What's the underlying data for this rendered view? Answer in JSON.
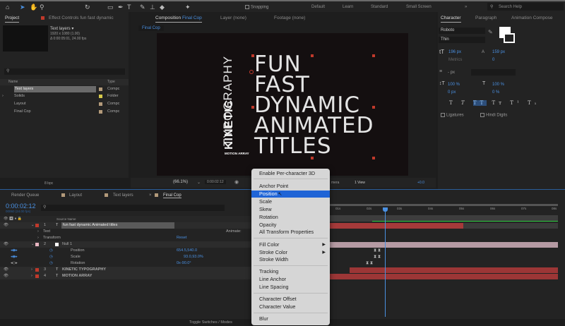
{
  "toolbar": {
    "snapping_label": "Snapping",
    "workspaces": [
      "Default",
      "Learn",
      "Standard",
      "Small Screen"
    ],
    "search_placeholder": "Search Help"
  },
  "project": {
    "tab_label": "Project",
    "effect_controls_label": "Effect Controls fun fast dynamic",
    "selected_name": "Text layers ▾",
    "selected_res": "1920 x 1080 (1.00)",
    "selected_dur": "Δ 0:00:05:01, 24.00 fps",
    "col_name": "Name",
    "col_type": "Type",
    "items": [
      {
        "name": "Text layers",
        "type": "Compc",
        "color": "#b39a7a"
      },
      {
        "name": "Solids",
        "type": "Folder",
        "color": "#d6c94a"
      },
      {
        "name": "Layout",
        "type": "Compc",
        "color": "#b39a7a"
      },
      {
        "name": "Final Cop",
        "type": "Compc",
        "color": "#b39a7a"
      }
    ],
    "bpc": "8 bpc"
  },
  "composition": {
    "tab_prefix": "Composition",
    "tab_name": "Final Cop",
    "layer_tab": "Layer (none)",
    "footage_tab": "Footage (none)",
    "breadcrumb": "Final Cop",
    "vertical_line1": "TYPOGRAPHY",
    "vertical_line2": "KINETIC",
    "vertical_line3": "MOTION ARRAY",
    "lines": [
      "FUN",
      "FAST",
      "DYNAMIC",
      "ANIMATED",
      "TITLES"
    ],
    "zoom": "(66.1%)",
    "timecode": "0:00:02:12",
    "camera": "mera",
    "view": "1 View",
    "exposure": "+0.0"
  },
  "character": {
    "tab_label": "Character",
    "paragraph_tab": "Paragraph",
    "animation_tab": "Animation Compose",
    "font": "Roboto",
    "style": "Thin",
    "font_size": "196 px",
    "leading": "159 px",
    "kerning": "Metrics",
    "tracking": "0",
    "stroke": "- px",
    "vscale": "100 %",
    "hscale": "100 %",
    "baseline": "0 px",
    "tsume": "0 %",
    "ligatures": "Ligatures",
    "hindi_digits": "Hindi Digits"
  },
  "timeline": {
    "tabs": [
      "Render Queue",
      "Layout",
      "Text layers",
      "Final Cop"
    ],
    "timecode": "0:00:02:12",
    "frames": "00060 (24.00 fps)",
    "col_source": "Source Name",
    "animate_label": "Animate:",
    "reset_label": "Reset",
    "layers": [
      {
        "num": "1",
        "name": "fun fast dynamic Animated titles",
        "color": "#c0392b"
      },
      {
        "num": "2",
        "name": "Null 1",
        "color": "#e8b4c0"
      },
      {
        "num": "3",
        "name": "KINETIC  TYPOGRAPHY",
        "color": "#c0392b"
      },
      {
        "num": "4",
        "name": "MOTION ARRAY",
        "color": "#c0392b"
      }
    ],
    "sub_text": "Text",
    "sub_transform": "Transform",
    "props": [
      {
        "name": "Position",
        "value": "654.5,540.0"
      },
      {
        "name": "Scale",
        "value": "93.0,93.0%"
      },
      {
        "name": "Rotation",
        "value": "0x-90.0°"
      }
    ],
    "ruler": [
      "01s",
      "02s",
      "03s",
      "04s",
      "05s",
      "06s",
      "07s",
      "08s"
    ],
    "toggle_label": "Toggle Switches / Modes"
  },
  "context_menu": {
    "items": [
      "Enable Per-character 3D",
      "Anchor Point",
      "Position",
      "Scale",
      "Skew",
      "Rotation",
      "Opacity",
      "All Transform Properties",
      "Fill Color",
      "Stroke Color",
      "Stroke Width",
      "Tracking",
      "Line Anchor",
      "Line Spacing",
      "Character Offset",
      "Character Value",
      "Blur"
    ],
    "selected": "Position"
  }
}
